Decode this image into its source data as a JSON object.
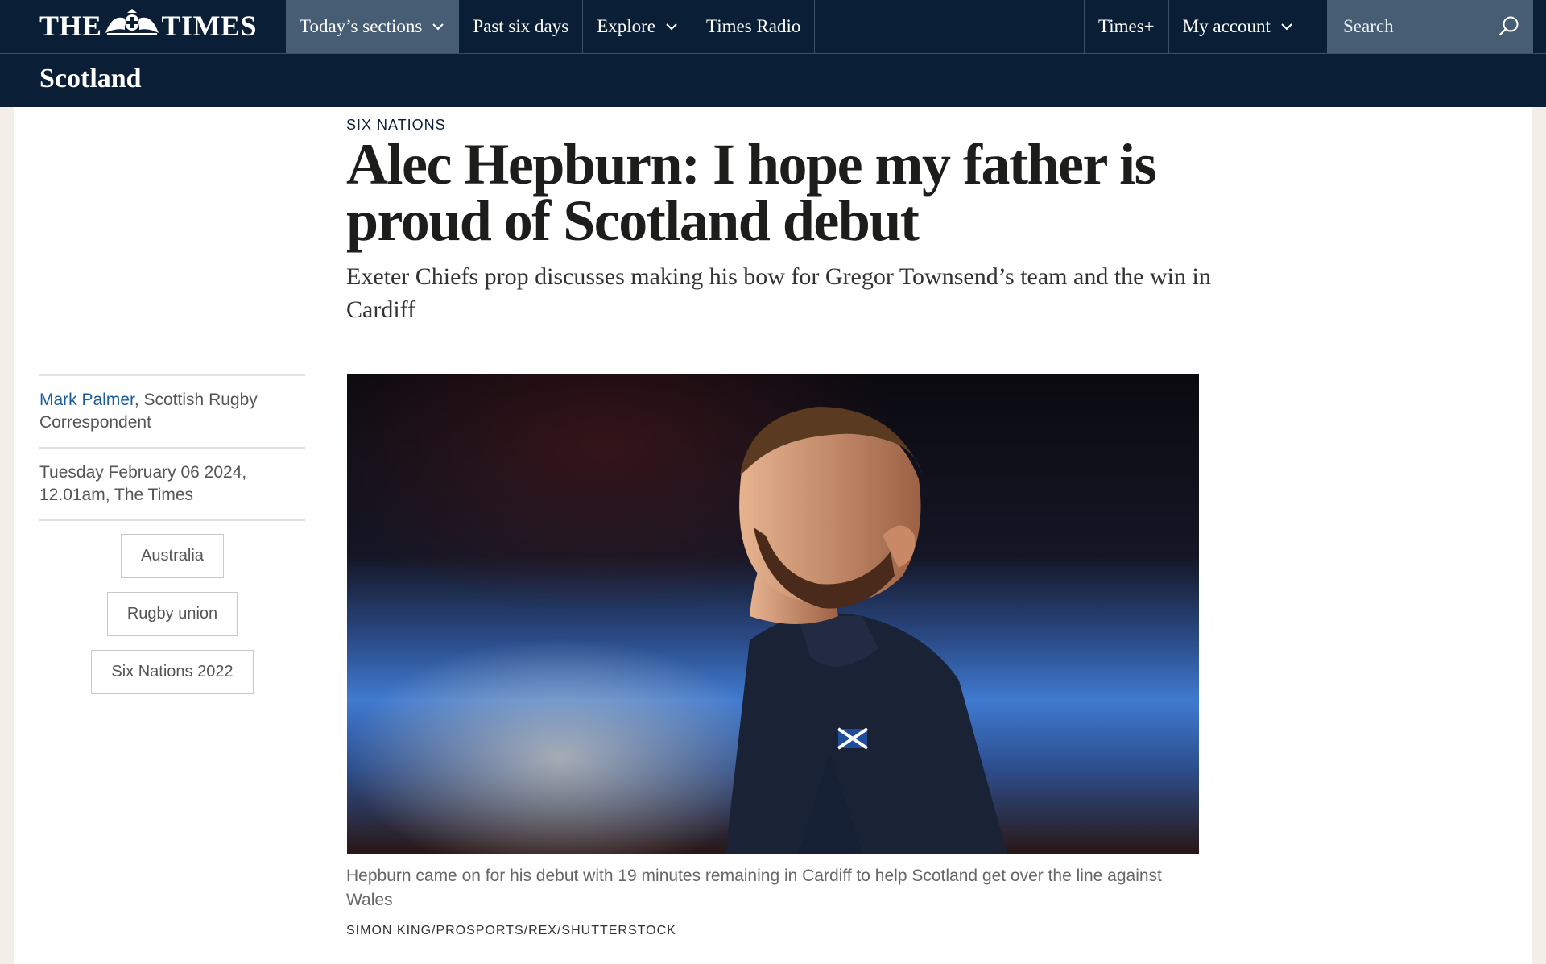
{
  "masthead": {
    "logo_left": "THE",
    "logo_right": "TIMES",
    "edition": "Scotland"
  },
  "nav": {
    "items": [
      {
        "label": "Today’s sections",
        "has_chevron": true,
        "active": true
      },
      {
        "label": "Past six days",
        "has_chevron": false
      },
      {
        "label": "Explore",
        "has_chevron": true
      },
      {
        "label": "Times Radio",
        "has_chevron": false
      }
    ],
    "right_items": [
      {
        "label": "Times+",
        "has_chevron": false
      },
      {
        "label": "My account",
        "has_chevron": true
      }
    ],
    "search_placeholder": "Search"
  },
  "article": {
    "kicker": "SIX NATIONS",
    "headline": "Alec Hepburn: I hope my father is proud of Scotland debut",
    "standfirst": "Exeter Chiefs prop discusses making his bow for Gregor Townsend’s team and the win in Cardiff",
    "author": "Mark Palmer",
    "author_role": ", Scottish Rugby Correspondent",
    "date": "Tuesday February 06 2024, 12.01am, The Times",
    "tags": [
      "Australia",
      "Rugby union",
      "Six Nations 2022"
    ],
    "image_caption": "Hepburn came on for his debut with 19 minutes remaining in Cardiff to help Scotland get over the line against Wales",
    "image_credit": "SIMON KING/PROSPORTS/REX/SHUTTERSTOCK"
  },
  "colors": {
    "header_bg": "#0a1f36",
    "active_nav_bg": "#475d74",
    "author_link": "#1a5c9e"
  }
}
